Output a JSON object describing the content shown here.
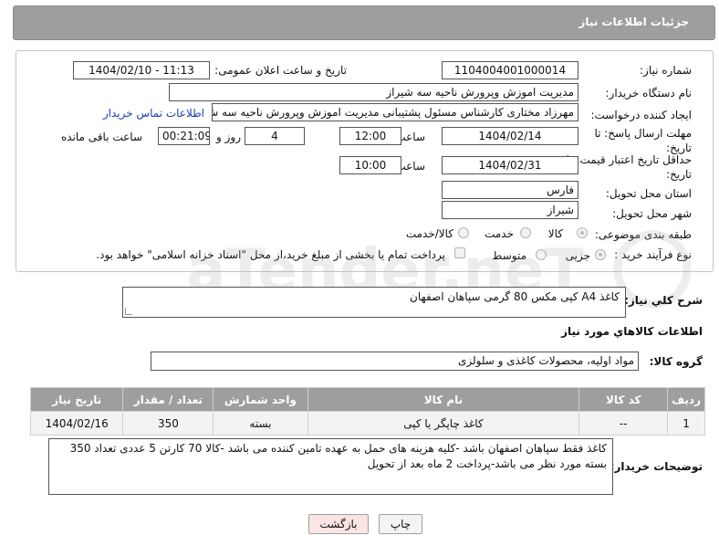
{
  "header": {
    "title": "جزئیات اطلاعات نیاز"
  },
  "form": {
    "need_number_label": "شماره نیاز:",
    "need_number": "1104004001000014",
    "announce_label": "تاریخ و ساعت اعلان عمومی:",
    "announce_value": "1404/02/10 - 11:13",
    "buyer_org_label": "نام دستگاه خریدار:",
    "buyer_org": "مدیریت اموزش وپرورش ناحیه سه شیراز",
    "creator_label": "ایجاد کننده درخواست:",
    "creator": "مهرزاد مختاری کارشناس مسئول پشتیبانی مدیریت اموزش وپرورش ناحیه سه ش",
    "contact_link": "اطلاعات تماس خریدار",
    "deadline_label": "مهلت ارسال پاسخ: تا تاریخ:",
    "deadline_date": "1404/02/14",
    "time_label": "ساعت",
    "deadline_time": "12:00",
    "days_value": "4",
    "days_label": "روز و",
    "remaining_time": "00:21:09",
    "remaining_label": "ساعت باقی مانده",
    "price_validity_label": "حداقل تاریخ اعتبار قیمت: تا تاریخ:",
    "price_validity_date": "1404/02/31",
    "price_validity_time": "10:00",
    "province_label": "استان محل تحویل:",
    "province": "فارس",
    "city_label": "شهر محل تحویل:",
    "city": "شیراز",
    "category_label": "طبقه بندی موضوعی:",
    "category_options": [
      "کالا",
      "خدمت",
      "کالا/خدمت"
    ],
    "category_selected": "کالا",
    "process_label": "نوع فرآیند خرید :",
    "process_options": [
      "جزیی",
      "متوسط"
    ],
    "process_selected": "جزیی",
    "payment_note": "پرداخت تمام یا بخشی از مبلغ خرید،از محل \"اسناد خزانه اسلامی\" خواهد بود."
  },
  "summary": {
    "label": "شرح کلي نياز:",
    "text": "کاغذ A4 کپی مکس 80 گرمی سپاهان اصفهان"
  },
  "goods": {
    "section_title": "اطلاعات کالاهاي مورد نياز",
    "group_label": "گروه کالا:",
    "group_value": "مواد اولیه، محصولات کاغذی و سلولزی",
    "columns": [
      "ردیف",
      "کد کالا",
      "نام کالا",
      "واحد شمارش",
      "تعداد / مقدار",
      "تاریخ نیاز"
    ],
    "rows": [
      {
        "row": "1",
        "code": "--",
        "name": "کاغذ چاپگر یا کپی",
        "unit": "بسته",
        "qty": "350",
        "date": "1404/02/16"
      }
    ]
  },
  "buyer_notes": {
    "label": "توضیحات خریدار:",
    "text": "کاغذ فقط سپاهان اصفهان باشد -کلیه هزینه های حمل به عهده تامین کننده می باشد -کالا 70 کارتن 5 عددی  تعداد 350 بسته مورد نظر می باشد-پرداخت 2 ماه بعد از تحویل"
  },
  "buttons": {
    "print": "چاپ",
    "back": "بازگشت"
  },
  "watermark": {
    "text": "AriaTender.neT"
  },
  "colors": {
    "header_bg": "#9e9e9e",
    "link": "#1a3fb0",
    "back_button_bg": "#fde4e4"
  }
}
